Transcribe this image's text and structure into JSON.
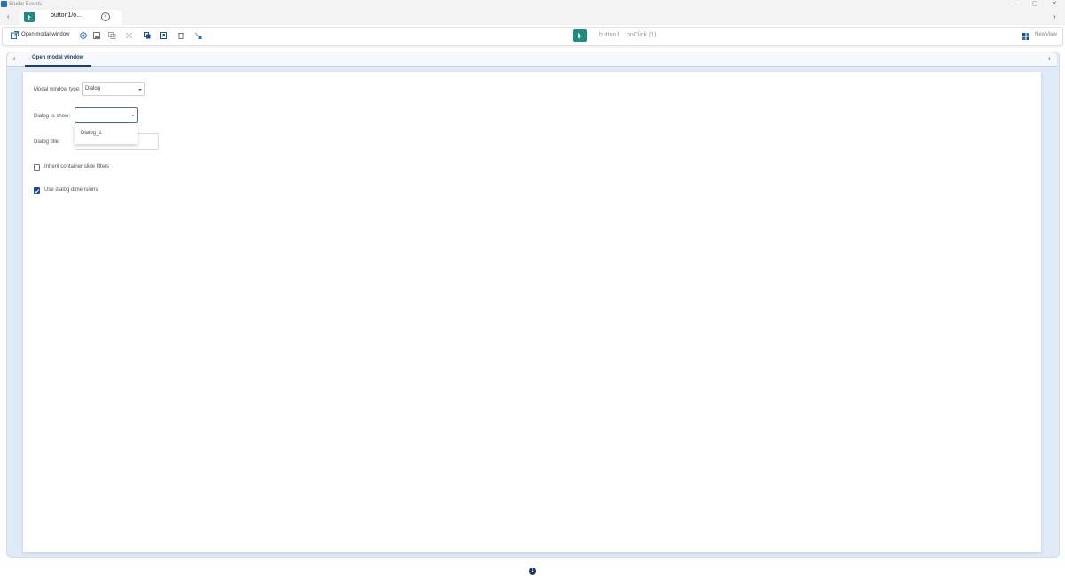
{
  "window": {
    "title": "Studio Events",
    "minimize": "–",
    "restore": "▢",
    "close": "✕"
  },
  "tabs": {
    "back": "‹",
    "forward": "›",
    "items": [
      {
        "label": "button1/o...",
        "close": "×"
      }
    ]
  },
  "toolbar": {
    "action_label": "Open modal window",
    "icons": [
      "add-icon",
      "save-icon",
      "copy-icon",
      "cut-icon",
      "paste-icon",
      "export-icon",
      "delete-icon",
      "link-icon"
    ],
    "component": "button1",
    "event": "onClick (1)",
    "view_label": "NewView"
  },
  "panel": {
    "back": "‹",
    "forward": "›",
    "tab_label": "Open modal window"
  },
  "form": {
    "modal_type_label": "Modal window type:",
    "modal_type_value": "Dialog",
    "dialog_show_label": "Dialog to show:",
    "dialog_show_value": "",
    "dialog_options": [
      "Dialog_1"
    ],
    "dialog_title_label": "Dialog title:",
    "dialog_title_value": "",
    "inherit_label": "Inherit container slide filters",
    "inherit_checked": false,
    "use_dims_label": "Use dialog dimensions",
    "use_dims_checked": true
  },
  "pagination": {
    "current_page": "1"
  },
  "colors": {
    "accent": "#1f3b66",
    "teal": "#1c8c80",
    "panel_bg": "#dfeaf7"
  }
}
